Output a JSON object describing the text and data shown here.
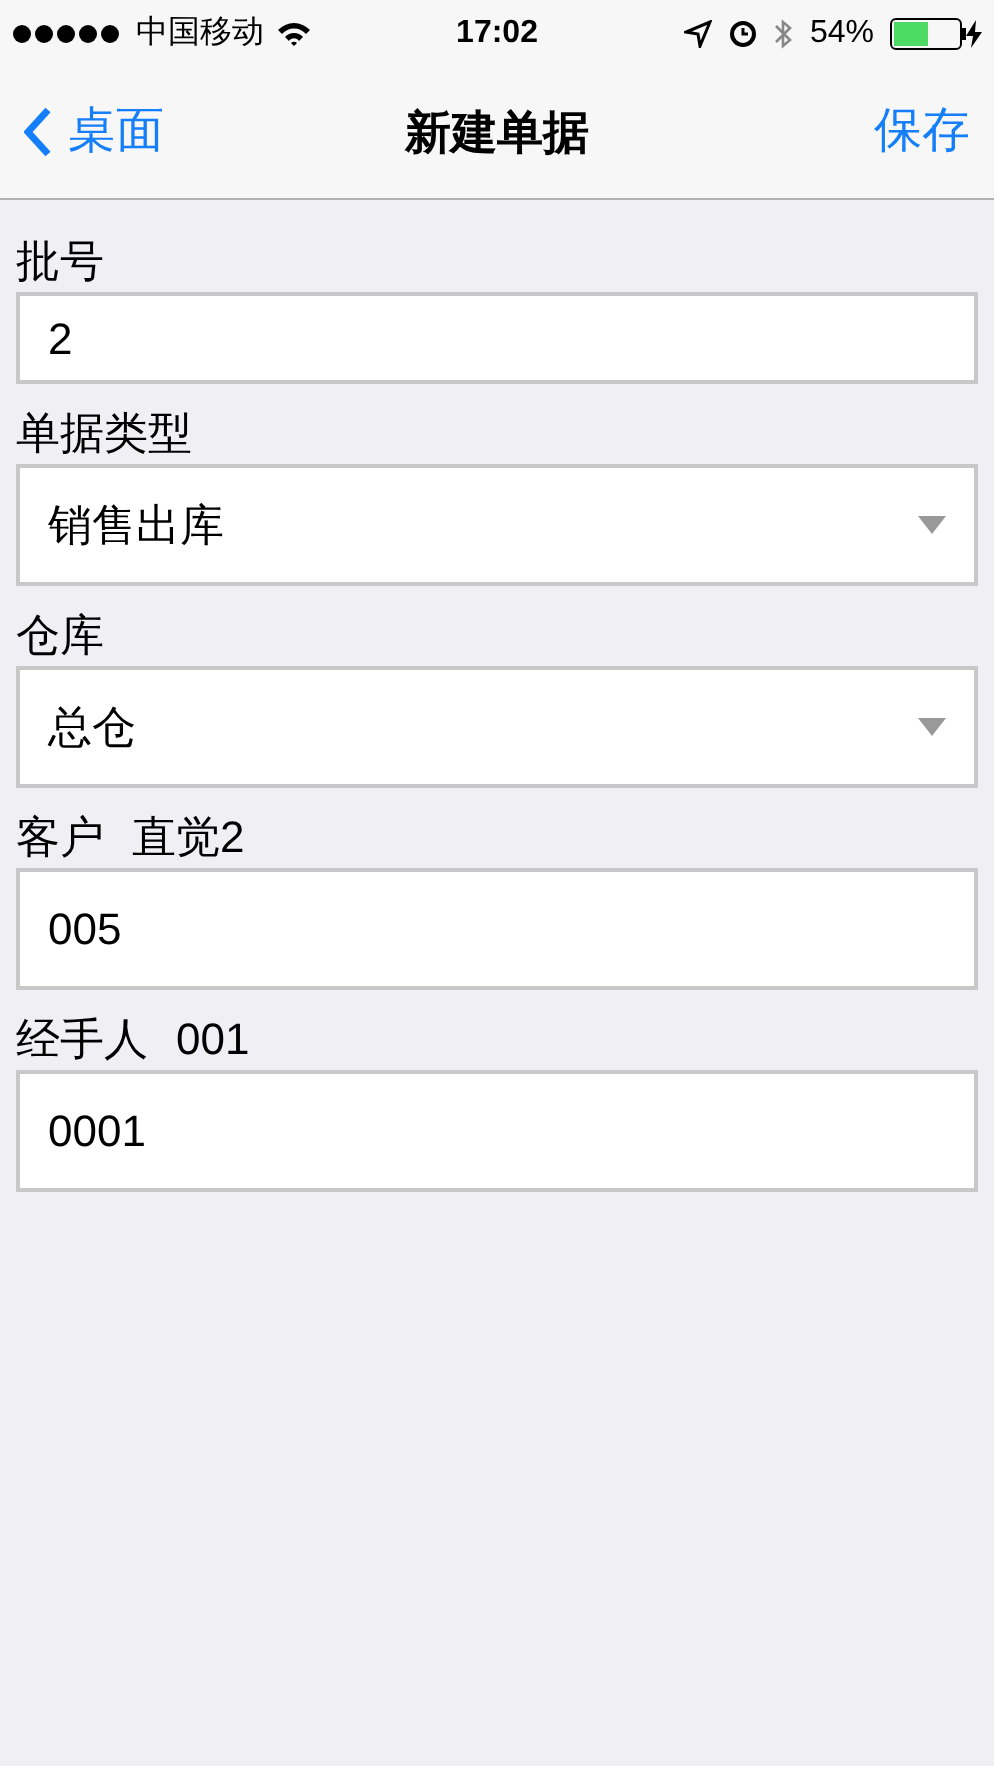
{
  "status_bar": {
    "carrier": "中国移动",
    "time": "17:02",
    "battery": "54%"
  },
  "nav": {
    "back": "桌面",
    "title": "新建单据",
    "action": "保存"
  },
  "fields": [
    {
      "kind": "text",
      "label": "批号",
      "value": "2"
    },
    {
      "kind": "select",
      "label": "单据类型",
      "value": "销售出库"
    },
    {
      "kind": "select",
      "label": "仓库",
      "value": "总仓"
    },
    {
      "kind": "text",
      "label": "客户",
      "note": "直觉2",
      "value": "005"
    },
    {
      "kind": "text",
      "label": "经手人",
      "note": "001",
      "value": "0001"
    }
  ]
}
